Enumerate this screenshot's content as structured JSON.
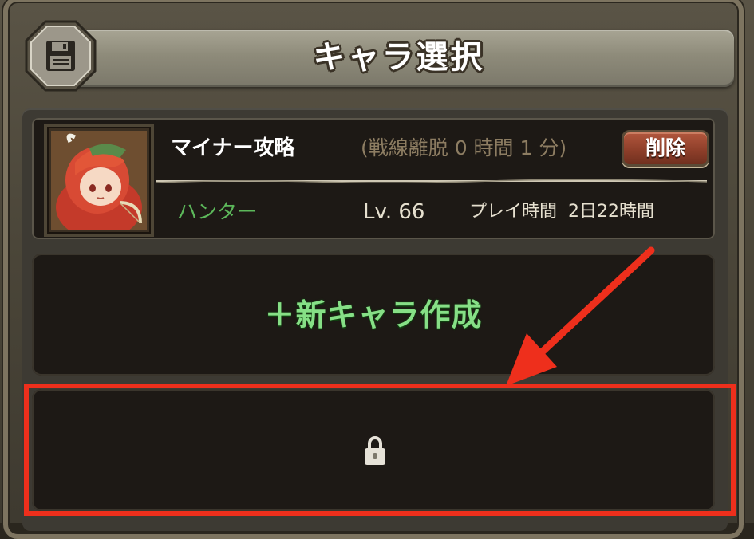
{
  "header": {
    "title": "キャラ選択",
    "save_icon": "floppy-disk-icon"
  },
  "characters": [
    {
      "name": "マイナー攻略",
      "offline_status": "(戦線離脱 0 時間 1 分)",
      "delete_label": "削除",
      "class": "ハンター",
      "level": "Lv. 66",
      "play_time": "プレイ時間  2日22時間"
    }
  ],
  "new_slot": {
    "label": "＋新キャラ作成"
  },
  "locked_slot": {
    "icon": "padlock-icon"
  },
  "colors": {
    "annotation": "#ee2f1c",
    "new_label": "#86df86",
    "class_text": "#5cb85a",
    "delete_button": "#a04a33"
  }
}
